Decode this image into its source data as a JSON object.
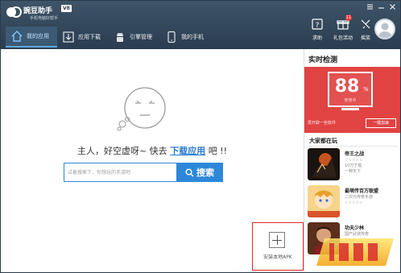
{
  "window": {
    "logo_name": "豌豆助手",
    "version_badge": "V8",
    "slogan": "手机电脑好帮手"
  },
  "tabs": [
    {
      "label": "我的应用",
      "icon": "home-icon",
      "active": true
    },
    {
      "label": "应用下载",
      "icon": "download-icon",
      "active": false
    },
    {
      "label": "引擎管理",
      "icon": "android-icon",
      "active": false
    },
    {
      "label": "我的手机",
      "icon": "phone-icon",
      "active": false
    }
  ],
  "toolbar": {
    "help_label": "求助",
    "gift_label": "礼包活动",
    "gift_badge": "11",
    "shake_label": "摇奖"
  },
  "main": {
    "empty_prefix": "主人，好空虚呀~ 快去",
    "empty_link": "下载应用",
    "empty_suffix": "吧 !!",
    "search_placeholder": "试着搜索下，你想玩的手游吧",
    "search_button": "搜索",
    "install_local": "安装本地APK"
  },
  "side": {
    "monitor_title": "实时检测",
    "score": "88",
    "score_unit": "%",
    "score_caption": "使用中",
    "hint": "再开辟一些软件",
    "accel_button": "一键加速",
    "playing_title": "大家都在玩",
    "games": [
      {
        "name": "帝王之战",
        "meta1": "☆☆☆☆☆",
        "meta2": "10万下载",
        "meta3": "一种天下"
      },
      {
        "name": "最萌传百万联盟",
        "meta1": "二次元传奇手游",
        "meta2": "☆☆☆☆☆"
      },
      {
        "name": "功夫少林",
        "meta1": "国产武侠传奇",
        "meta2": "☆☆☆☆☆"
      }
    ]
  },
  "colors": {
    "titlebar": "#2b3d50",
    "accent_blue": "#2d88d9",
    "monitor_red": "#e14343",
    "highlight_border": "#e02b2b"
  }
}
